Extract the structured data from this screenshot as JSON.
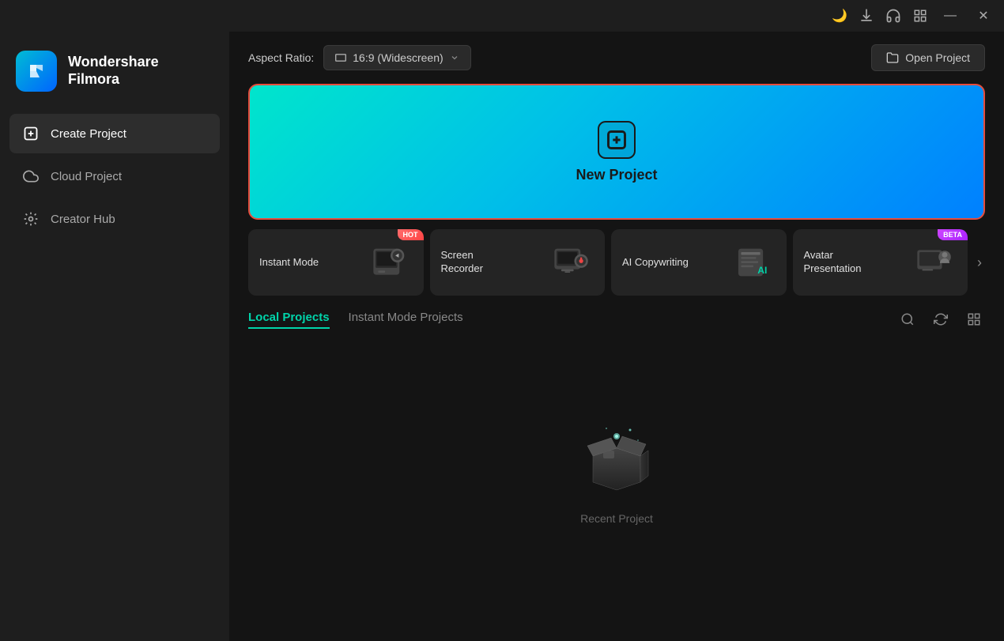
{
  "titlebar": {
    "icons": [
      {
        "name": "theme-icon",
        "symbol": "🌙"
      },
      {
        "name": "download-icon",
        "symbol": "⬇"
      },
      {
        "name": "headset-icon",
        "symbol": "🎧"
      },
      {
        "name": "grid-icon",
        "symbol": "⊞"
      }
    ],
    "minimize_label": "—",
    "close_label": "✕"
  },
  "sidebar": {
    "logo_title_line1": "Wondershare",
    "logo_title_line2": "Filmora",
    "nav_items": [
      {
        "id": "create-project",
        "label": "Create Project",
        "active": true
      },
      {
        "id": "cloud-project",
        "label": "Cloud Project",
        "active": false
      },
      {
        "id": "creator-hub",
        "label": "Creator Hub",
        "active": false
      }
    ]
  },
  "topbar": {
    "aspect_ratio_label": "Aspect Ratio:",
    "aspect_ratio_value": "16:9 (Widescreen)",
    "open_project_label": "Open Project"
  },
  "new_project": {
    "label": "New Project"
  },
  "quick_actions": [
    {
      "id": "instant-mode",
      "label": "Instant Mode",
      "badge": "HOT",
      "emoji": "🎬"
    },
    {
      "id": "screen-recorder",
      "label": "Screen Recorder",
      "badge": null,
      "emoji": "🖥"
    },
    {
      "id": "ai-copywriting",
      "label": "AI Copywriting",
      "badge": null,
      "emoji": "🤖"
    },
    {
      "id": "avatar-presentation",
      "label": "Avatar Presentation",
      "badge": "BETA",
      "emoji": "👤"
    }
  ],
  "projects": {
    "tabs": [
      {
        "id": "local",
        "label": "Local Projects",
        "active": true
      },
      {
        "id": "instant",
        "label": "Instant Mode Projects",
        "active": false
      }
    ],
    "empty_state_label": "Recent Project"
  }
}
